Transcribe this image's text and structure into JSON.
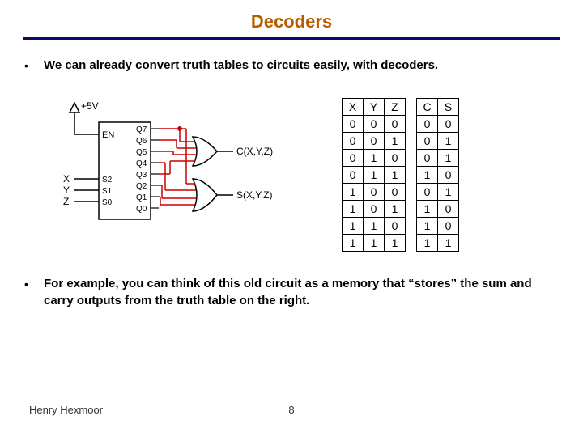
{
  "title": "Decoders",
  "bullets": [
    "We can already convert truth tables to circuits easily, with decoders.",
    "For example, you can think of this old circuit as a memory that “stores” the sum and carry outputs from the truth table on the right."
  ],
  "circuit": {
    "voltage": "+5V",
    "enable": "EN",
    "inputs": [
      "X",
      "Y",
      "Z"
    ],
    "input_pins": [
      "S2",
      "S1",
      "S0"
    ],
    "outputs": [
      "Q7",
      "Q6",
      "Q5",
      "Q4",
      "Q3",
      "Q2",
      "Q1",
      "Q0"
    ],
    "gate_labels": [
      "C(X,Y,Z)",
      "S(X,Y,Z)"
    ]
  },
  "chart_data": {
    "type": "table",
    "title": "",
    "columns_left": [
      "X",
      "Y",
      "Z"
    ],
    "columns_right": [
      "C",
      "S"
    ],
    "rows": [
      {
        "xyz": [
          0,
          0,
          0
        ],
        "cs": [
          0,
          0
        ]
      },
      {
        "xyz": [
          0,
          0,
          1
        ],
        "cs": [
          0,
          1
        ]
      },
      {
        "xyz": [
          0,
          1,
          0
        ],
        "cs": [
          0,
          1
        ]
      },
      {
        "xyz": [
          0,
          1,
          1
        ],
        "cs": [
          1,
          0
        ]
      },
      {
        "xyz": [
          1,
          0,
          0
        ],
        "cs": [
          0,
          1
        ]
      },
      {
        "xyz": [
          1,
          0,
          1
        ],
        "cs": [
          1,
          0
        ]
      },
      {
        "xyz": [
          1,
          1,
          0
        ],
        "cs": [
          1,
          0
        ]
      },
      {
        "xyz": [
          1,
          1,
          1
        ],
        "cs": [
          1,
          1
        ]
      }
    ]
  },
  "footer": {
    "author": "Henry Hexmoor",
    "page": "8"
  }
}
